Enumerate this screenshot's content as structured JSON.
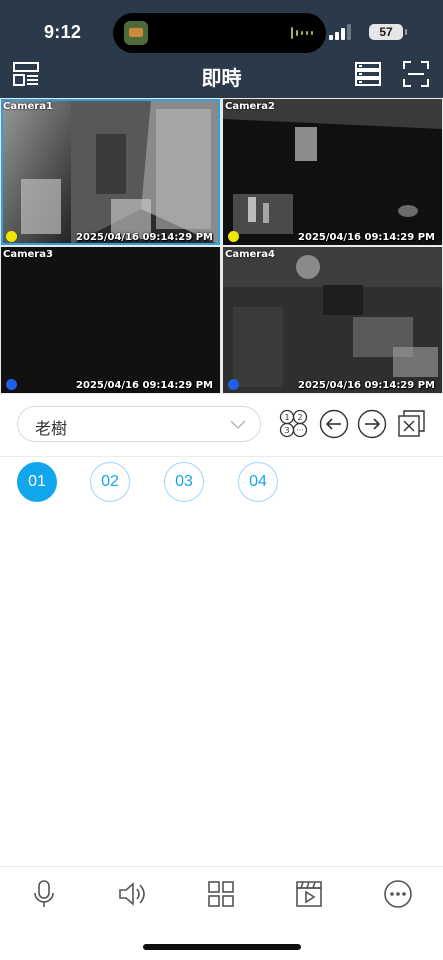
{
  "status_bar": {
    "time": "9:12",
    "battery": "57"
  },
  "nav": {
    "title": "即時"
  },
  "cameras": [
    {
      "label": "Camera1",
      "timestamp": "2025/04/16 09:14:29 PM",
      "dot_color": "#f2e600",
      "selected": true
    },
    {
      "label": "Camera2",
      "timestamp": "2025/04/16 09:14:29 PM",
      "dot_color": "#f2e600",
      "selected": false
    },
    {
      "label": "Camera3",
      "timestamp": "2025/04/16 09:14:29 PM",
      "dot_color": "#1f5fe8",
      "selected": false
    },
    {
      "label": "Camera4",
      "timestamp": "2025/04/16 09:14:29 PM",
      "dot_color": "#1f5fe8",
      "selected": false
    }
  ],
  "device_select": {
    "value": "老樹"
  },
  "channels": [
    {
      "label": "01",
      "active": true
    },
    {
      "label": "02",
      "active": false
    },
    {
      "label": "03",
      "active": false
    },
    {
      "label": "04",
      "active": false
    }
  ],
  "colors": {
    "header": "#2b3a4a",
    "accent": "#12a7ec",
    "selection_border": "#2fa0dd"
  },
  "icons": {
    "nav_left": "layout-list-icon",
    "nav_right": [
      "device-list-icon",
      "fullscreen-scan-icon"
    ],
    "controls": [
      "numbered-layout-icon",
      "arrow-left-circle-icon",
      "arrow-right-circle-icon",
      "close-all-icon"
    ],
    "bottom_bar": [
      "microphone-icon",
      "speaker-icon",
      "grid-layout-icon",
      "playback-clapper-icon",
      "more-icon"
    ]
  }
}
